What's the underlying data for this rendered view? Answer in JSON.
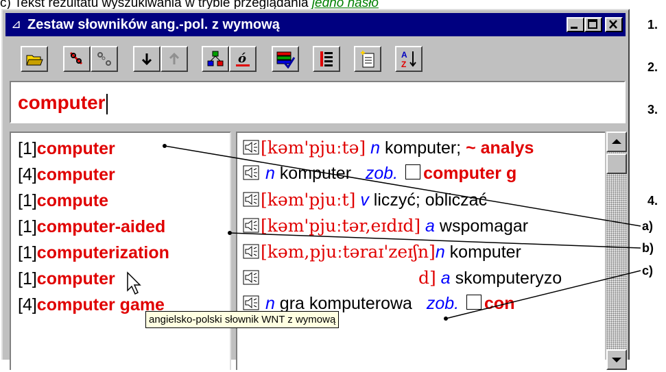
{
  "caption": {
    "text": "c) Tekst rezultatu wyszukiwania w trybie przeglądania ",
    "link": "jedno hasło"
  },
  "window": {
    "title": "Zestaw słowników ang.-pol. z wymową"
  },
  "search": {
    "value": "computer"
  },
  "results": [
    {
      "num": "[1]",
      "word": "computer"
    },
    {
      "num": "[4]",
      "word": "computer"
    },
    {
      "num": "[1]",
      "word": "compute"
    },
    {
      "num": "[1]",
      "word": "computer-aided"
    },
    {
      "num": "[1]",
      "word": "computerization"
    },
    {
      "num": "[1]",
      "word": "computer"
    },
    {
      "num": "[4]",
      "word": "computer game"
    }
  ],
  "entries": {
    "e1": {
      "pron": "[kəm'pjuːtə]",
      "pos": "n",
      "text": " komputer; ",
      "red": "~ analys"
    },
    "e2": {
      "pos": "n",
      "text": " komputer",
      "ref": "zob.",
      "red": "computer g"
    },
    "e3": {
      "pron": "[kəm'pjuːt]",
      "pos": "v",
      "text": " liczyć; obliczać"
    },
    "e4": {
      "pron": "[kəm'pjuːtər,eɪdɪd]",
      "pos": "a",
      "text": " wspomagar"
    },
    "e5": {
      "pron": "[kəm,pjuːtəraɪ'zeɪʃn]",
      "pos": "n",
      "text": " komputer"
    },
    "e6": {
      "pron": "d]",
      "pos": "a",
      "text": " skomputeryzo"
    },
    "e7": {
      "pos": "n",
      "text": " gra komputerowa",
      "ref": "zob.",
      "red": "con"
    }
  },
  "tooltip": "angielsko-polski słownik WNT z wymową",
  "annotations": {
    "n1": "1.",
    "n2": "2.",
    "n3": "3.",
    "n4": "4.",
    "a": "a)",
    "b": "b)",
    "c": "c)"
  },
  "icons": [
    "open-folder-icon",
    "link-icon",
    "unlink-icon",
    "arrow-down-icon",
    "arrow-up-icon",
    "tree-icon",
    "accent-o-icon",
    "books-check-icon",
    "list-icon",
    "new-page-icon",
    "sort-az-icon",
    "speaker-icon"
  ],
  "colors": {
    "titlebar": "#000080",
    "headword": "#e00000",
    "pos": "#0000ff",
    "link": "#008000"
  }
}
